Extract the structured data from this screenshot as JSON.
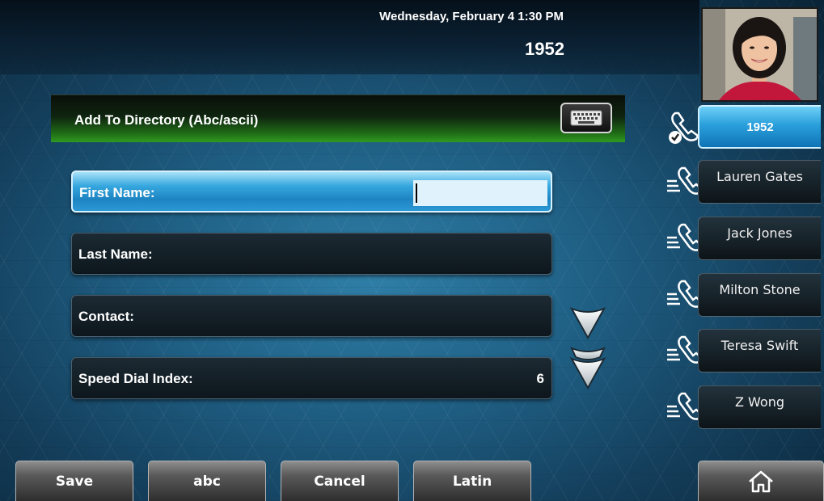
{
  "status": {
    "datetime": "Wednesday, February 4  1:30 PM",
    "extension": "1952"
  },
  "title_bar": {
    "title": "Add To Directory (Abc/ascii)",
    "keyboard_icon": "keyboard-icon"
  },
  "fields": [
    {
      "label": "First Name:",
      "value": "",
      "selected": true
    },
    {
      "label": "Last Name:",
      "value": ""
    },
    {
      "label": "Contact:",
      "value": ""
    },
    {
      "label": "Speed Dial Index:",
      "value": "6"
    }
  ],
  "lines": [
    {
      "label": "1952",
      "icon": "registered-line-icon",
      "active": true
    },
    {
      "label": "Lauren Gates",
      "icon": "speed-dial-icon"
    },
    {
      "label": "Jack Jones",
      "icon": "speed-dial-icon"
    },
    {
      "label": "Milton Stone",
      "icon": "speed-dial-icon"
    },
    {
      "label": "Teresa Swift",
      "icon": "speed-dial-icon"
    },
    {
      "label": "Z Wong",
      "icon": "speed-dial-icon"
    }
  ],
  "softkeys": [
    {
      "label": "Save"
    },
    {
      "label": "abc"
    },
    {
      "label": "Cancel"
    },
    {
      "label": "Latin"
    }
  ],
  "home_key": {
    "icon": "home-icon"
  },
  "colors": {
    "selected_blue": "#2b98d4",
    "title_green": "#2f9a20",
    "background": "#1f5f84"
  }
}
